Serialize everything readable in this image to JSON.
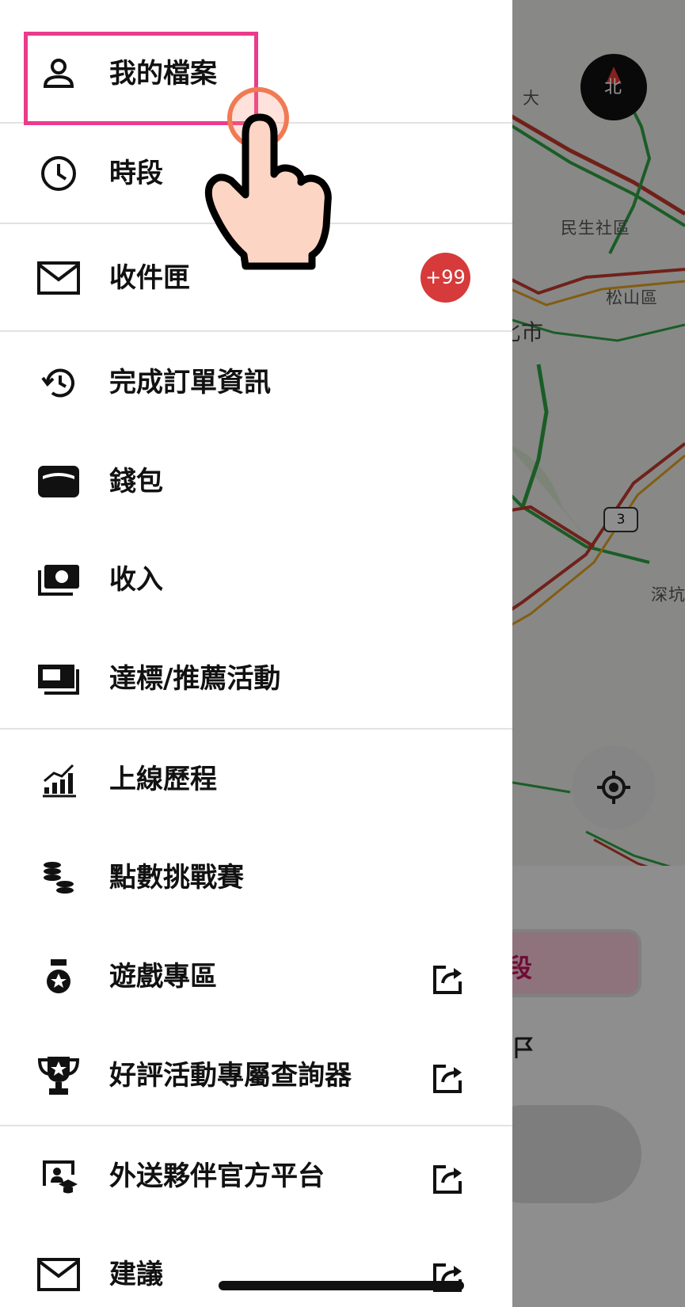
{
  "map": {
    "labels": [
      "大",
      "區",
      "民生社區",
      "松山區",
      "臺北市",
      "深坑"
    ],
    "route_number": "3",
    "compass_label": "北",
    "shift_chip_label": "時段"
  },
  "drawer": {
    "items": [
      {
        "label": "我的檔案",
        "icon": "person-icon"
      },
      {
        "label": "時段",
        "icon": "clock-icon"
      },
      {
        "label": "收件匣",
        "icon": "mail-icon",
        "badge": "+99"
      },
      {
        "label": "完成訂單資訊",
        "icon": "history-icon"
      },
      {
        "label": "錢包",
        "icon": "wallet-icon"
      },
      {
        "label": "收入",
        "icon": "cash-icon"
      },
      {
        "label": "達標/推薦活動",
        "icon": "cards-icon"
      },
      {
        "label": "上線歷程",
        "icon": "trend-chart-icon"
      },
      {
        "label": "點數挑戰賽",
        "icon": "coins-icon"
      },
      {
        "label": "遊戲專區",
        "icon": "medal-icon",
        "external": true
      },
      {
        "label": "好評活動專屬查詢器",
        "icon": "trophy-icon",
        "external": true
      },
      {
        "label": "外送夥伴官方平台",
        "icon": "graduation-icon",
        "external": true
      },
      {
        "label": "建議",
        "icon": "mail-icon",
        "external": true
      }
    ]
  },
  "colors": {
    "badge": "#d63a3a",
    "highlight": "#ea3b8c",
    "accent": "#c0135e"
  }
}
